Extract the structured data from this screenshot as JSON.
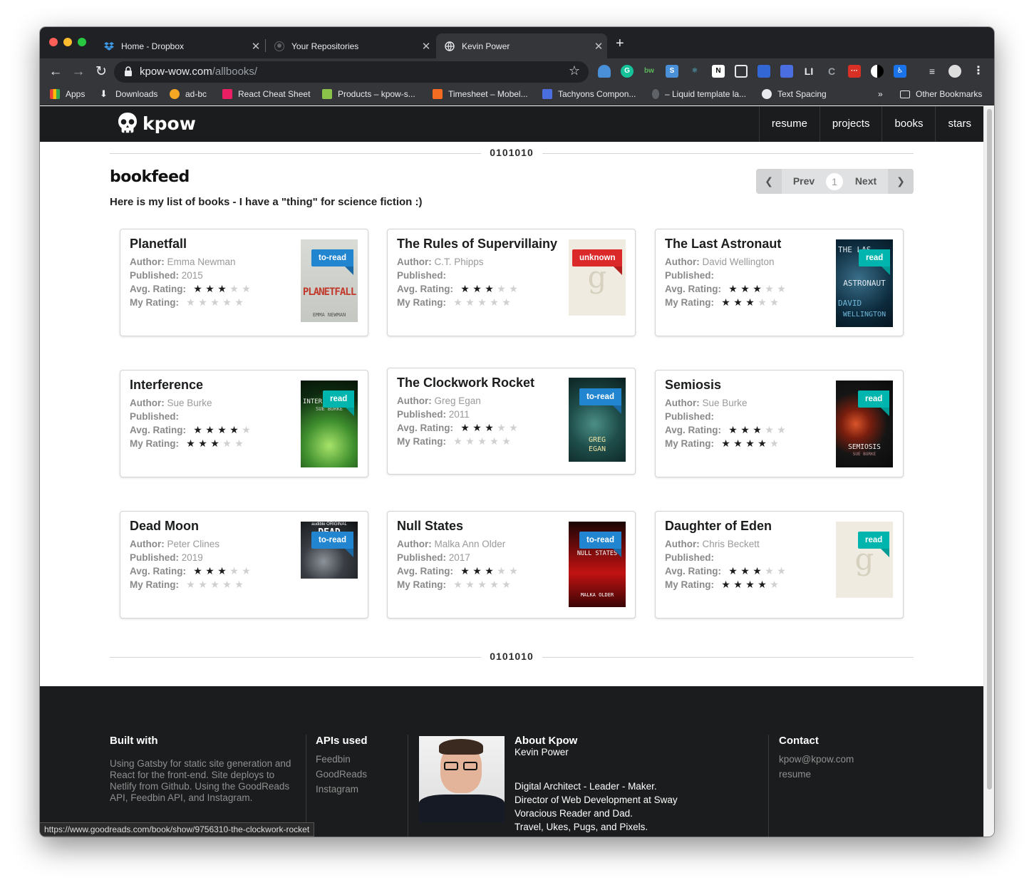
{
  "browser": {
    "tabs": [
      {
        "title": "Home - Dropbox",
        "icon": "dropbox-icon"
      },
      {
        "title": "Your Repositories",
        "icon": "github-icon"
      },
      {
        "title": "Kevin Power",
        "icon": "globe-icon"
      }
    ],
    "url_host": "kpow-wow.com",
    "url_path": "/allbooks/",
    "bookmarks": [
      {
        "label": "Apps"
      },
      {
        "label": "Downloads"
      },
      {
        "label": "ad-bc"
      },
      {
        "label": "React Cheat Sheet"
      },
      {
        "label": "Products – kpow-s..."
      },
      {
        "label": "Timesheet – Mobel..."
      },
      {
        "label": "Tachyons Compon..."
      },
      {
        "label": "– Liquid template la..."
      },
      {
        "label": "Text Spacing"
      }
    ],
    "more_bookmarks": "»",
    "other_bookmarks": "Other Bookmarks",
    "status_url": "https://www.goodreads.com/book/show/9756310-the-clockwork-rocket"
  },
  "site": {
    "logo": "kpow",
    "nav": [
      "resume",
      "projects",
      "books",
      "stars"
    ],
    "divider": "0101010",
    "heading": "bookfeed",
    "subheading": "Here is my list of books - I have a \"thing\" for science fiction :)",
    "pager": {
      "prev": "Prev",
      "page": "1",
      "next": "Next"
    }
  },
  "labels": {
    "author": "Author:",
    "published": "Published:",
    "avg": "Avg. Rating:",
    "mine": "My Rating:"
  },
  "books": [
    {
      "title": "Planetfall",
      "author": "Emma Newman",
      "published": "2015",
      "avg": 3,
      "mine": 0,
      "shelf": "to-read"
    },
    {
      "title": "The Rules of Supervillainy",
      "author": "C.T. Phipps",
      "published": "",
      "avg": 3,
      "mine": 0,
      "shelf": "unknown"
    },
    {
      "title": "The Last Astronaut",
      "author": "David Wellington",
      "published": "",
      "avg": 3,
      "mine": 3,
      "shelf": "read"
    },
    {
      "title": "Interference",
      "author": "Sue Burke",
      "published": "",
      "avg": 4,
      "mine": 3,
      "shelf": "read"
    },
    {
      "title": "The Clockwork Rocket",
      "author": "Greg Egan",
      "published": "2011",
      "avg": 3,
      "mine": 0,
      "shelf": "to-read"
    },
    {
      "title": "Semiosis",
      "author": "Sue Burke",
      "published": "",
      "avg": 3,
      "mine": 4,
      "shelf": "read"
    },
    {
      "title": "Dead Moon",
      "author": "Peter Clines",
      "published": "2019",
      "avg": 3,
      "mine": 0,
      "shelf": "to-read"
    },
    {
      "title": "Null States",
      "author": "Malka Ann Older",
      "published": "2017",
      "avg": 3,
      "mine": 0,
      "shelf": "to-read"
    },
    {
      "title": "Daughter of Eden",
      "author": "Chris Beckett",
      "published": "",
      "avg": 3,
      "mine": 4,
      "shelf": "read"
    }
  ],
  "covers": {
    "planetfall": "PLANETFALL",
    "planetfall_author": "EMMA NEWMAN",
    "astronaut_top": "THE LAS",
    "astronaut_mid": "ASTRONAUT",
    "astronaut_author1": "DAVID",
    "astronaut_author2": "WELLINGTON",
    "interference": "INTER",
    "interference_author": "SUE BURKE",
    "clockwork_author1": "GREG",
    "clockwork_author2": "EGAN",
    "semiosis": "SEMIOSIS",
    "semiosis_author": "SUE BURKE",
    "deadmoon_top": "audible ORIGINAL",
    "deadmoon_title": "DEAD",
    "nullstates": "NULL STATES",
    "nullstates_author": "MALKA OLDER",
    "placeholder_glyph": "g"
  },
  "footer": {
    "built_head": "Built with",
    "built_text": "Using Gatsby for static site generation and React for the front-end. Site deploys to Netlify from Github. Using the GoodReads API, Feedbin API, and Instagram.",
    "apis_head": "APIs used",
    "apis": [
      "Feedbin",
      "GoodReads",
      "Instagram"
    ],
    "about_head": "About Kpow",
    "about_name": "Kevin Power",
    "about_lines": [
      "Digital Architect - Leader - Maker.",
      "Director of Web Development at Sway",
      "Voracious Reader and Dad.",
      "Travel, Ukes, Pugs, and Pixels."
    ],
    "contact_head": "Contact",
    "contact_links": [
      "kpow@kpow.com",
      "resume"
    ]
  },
  "colors": {
    "to_read": "#2185d0",
    "read": "#00b5ad",
    "unknown": "#db2828",
    "dark": "#1b1c1d"
  }
}
